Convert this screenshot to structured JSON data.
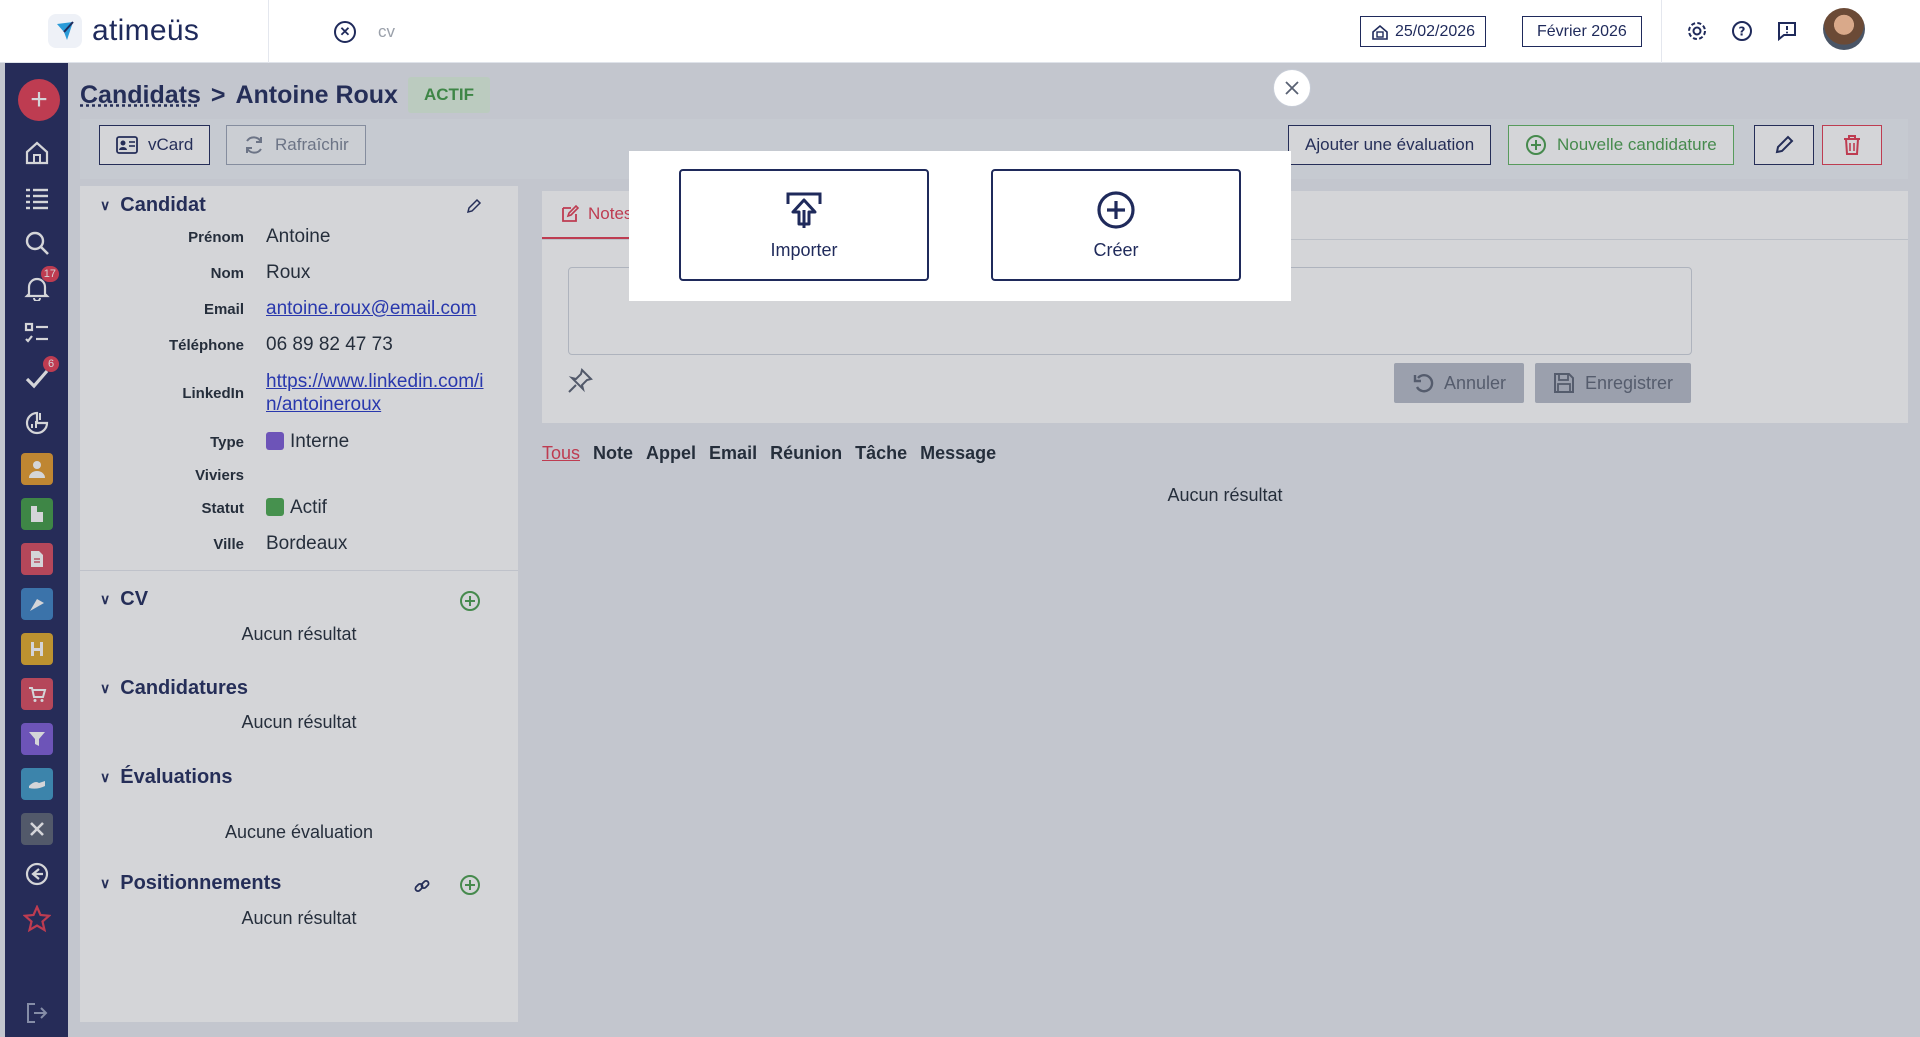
{
  "header": {
    "brand": "atimeüs",
    "search_text": "cv",
    "date_value": "25/02/2026",
    "period_value": "Février 2026"
  },
  "sidebar": {
    "notifications_badge": "17",
    "tasks_badge": "6",
    "tiles": [
      {
        "name": "candidates",
        "color": "#e59a2b"
      },
      {
        "name": "clients",
        "color": "#3f9a45"
      },
      {
        "name": "documents",
        "color": "#d84a5e"
      },
      {
        "name": "missions",
        "color": "#3b82c4"
      },
      {
        "name": "planning",
        "color": "#e0a928"
      },
      {
        "name": "shop",
        "color": "#d84a5e"
      },
      {
        "name": "filter",
        "color": "#7b5ad6"
      },
      {
        "name": "handshake",
        "color": "#3d98c6"
      },
      {
        "name": "tools",
        "color": "#596173"
      }
    ]
  },
  "page": {
    "breadcrumb_root": "Candidats",
    "breadcrumb_sep": ">",
    "breadcrumb_current": "Antoine Roux",
    "status": "ACTIF"
  },
  "toolbar": {
    "vcard": "vCard",
    "refresh": "Rafraîchir",
    "add_evaluation": "Ajouter une évaluation",
    "new_application": "Nouvelle candidature"
  },
  "candidate": {
    "section_title": "Candidat",
    "fields": [
      {
        "label": "Prénom",
        "value": "Antoine"
      },
      {
        "label": "Nom",
        "value": "Roux"
      },
      {
        "label": "Email",
        "value": "antoine.roux@email.com"
      },
      {
        "label": "Téléphone",
        "value": "06 89 82 47 73"
      },
      {
        "label": "LinkedIn",
        "value": "https://www.linkedin.com/in/antoineroux",
        "line1": "https://www.linkedin.com/i",
        "line2": "n/antoineroux"
      },
      {
        "label": "Type",
        "value": "Interne",
        "color": "#7b5ad6"
      },
      {
        "label": "Viviers",
        "value": ""
      },
      {
        "label": "Statut",
        "value": "Actif",
        "color": "#4aa84f"
      },
      {
        "label": "Ville",
        "value": "Bordeaux"
      }
    ]
  },
  "sections": {
    "cv": {
      "title": "CV",
      "empty": "Aucun résultat"
    },
    "applications": {
      "title": "Candidatures",
      "empty": "Aucun résultat"
    },
    "evaluations": {
      "title": "Évaluations",
      "empty": "Aucune évaluation"
    },
    "positions": {
      "title": "Positionnements",
      "empty": "Aucun résultat"
    }
  },
  "notes": {
    "tab_label": "Notes",
    "cancel": "Annuler",
    "save": "Enregistrer"
  },
  "filters": [
    "Tous",
    "Note",
    "Appel",
    "Email",
    "Réunion",
    "Tâche",
    "Message"
  ],
  "activity_empty": "Aucun résultat",
  "modal": {
    "import_label": "Importer",
    "create_label": "Créer"
  }
}
